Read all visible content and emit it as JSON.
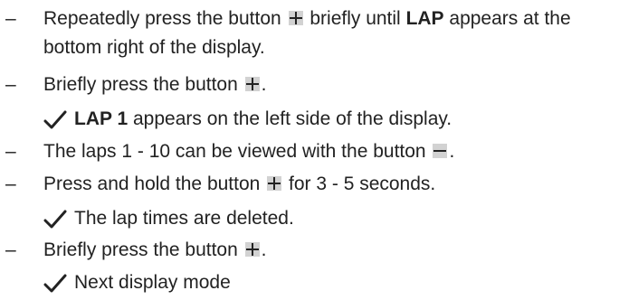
{
  "icons": {
    "plus": "plus-button-icon",
    "minus": "minus-button-icon",
    "check": "checkmark-icon"
  },
  "steps": [
    {
      "kind": "step",
      "dash": "–",
      "a": "Repeatedly press the button ",
      "b": " briefly until ",
      "bold": "LAP",
      "c": " appears at the",
      "line2": "bottom right of the display."
    },
    {
      "kind": "step",
      "dash": "–",
      "a": "Briefly press the button ",
      "c": "."
    },
    {
      "kind": "result",
      "bold": "LAP 1",
      "c": " appears on the left side of the display."
    },
    {
      "kind": "step",
      "dash": "–",
      "a": "The laps 1 - 10 can be viewed with the button ",
      "c": "."
    },
    {
      "kind": "step",
      "dash": "–",
      "a": "Press and hold the button ",
      "c": " for 3 - 5 seconds."
    },
    {
      "kind": "result",
      "c": "The lap times are deleted."
    },
    {
      "kind": "step",
      "dash": "–",
      "a": "Briefly press the button ",
      "c": "."
    },
    {
      "kind": "result",
      "c": "Next display mode"
    }
  ]
}
